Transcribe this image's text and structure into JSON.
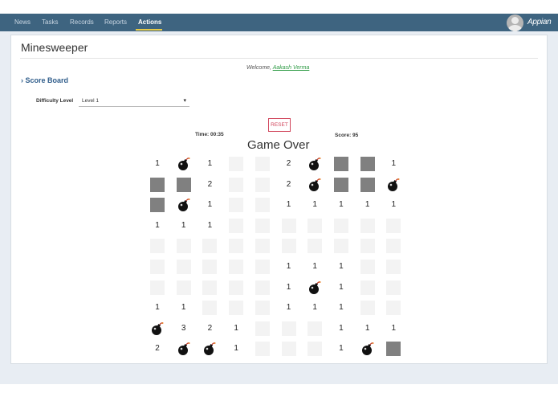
{
  "nav": {
    "items": [
      {
        "label": "News"
      },
      {
        "label": "Tasks"
      },
      {
        "label": "Records"
      },
      {
        "label": "Reports"
      },
      {
        "label": "Actions"
      }
    ],
    "active": "Actions",
    "brand": "Appian"
  },
  "page": {
    "title": "Minesweeper",
    "welcome_prefix": "Welcome,",
    "user_name": "Aakash Verma",
    "scoreboard_label": "Score Board"
  },
  "difficulty": {
    "label": "Difficulty Level",
    "selected": "Level 1"
  },
  "game": {
    "reset_label": "RESET",
    "time_text": "Time: 00:35",
    "score_text": "Score: 95",
    "status_text": "Game Over"
  },
  "board": [
    [
      "1",
      "B",
      "1",
      "",
      "",
      "2",
      "B",
      "G",
      "G",
      "1"
    ],
    [
      "G",
      "G",
      "2",
      "",
      "",
      "2",
      "B",
      "G",
      "G",
      "B"
    ],
    [
      "G",
      "B",
      "1",
      "",
      "",
      "1",
      "1",
      "1",
      "1",
      "1"
    ],
    [
      "1",
      "1",
      "1",
      "",
      "",
      "",
      "",
      "",
      "",
      ""
    ],
    [
      "",
      "",
      "",
      "",
      "",
      "",
      "",
      "",
      "",
      ""
    ],
    [
      "",
      "",
      "",
      "",
      "",
      "1",
      "1",
      "1",
      "",
      ""
    ],
    [
      "",
      "",
      "",
      "",
      "",
      "1",
      "B",
      "1",
      "",
      ""
    ],
    [
      "1",
      "1",
      "",
      "",
      "",
      "1",
      "1",
      "1",
      "",
      ""
    ],
    [
      "B",
      "3",
      "2",
      "1",
      "",
      "",
      "",
      "1",
      "1",
      "1"
    ],
    [
      "2",
      "B",
      "B",
      "1",
      "",
      "",
      "",
      "1",
      "B",
      "G"
    ]
  ],
  "colors": {
    "topbar": "#3e6480",
    "active_underline": "#e4c847",
    "reset": "#d1465c",
    "link": "#2e9b45",
    "scoreboard": "#2e5c8a",
    "revealed_gray": "#808080",
    "hidden_cell": "#f3f3f3"
  },
  "icons": {
    "bomb": "bomb-icon",
    "chevron": "chevron-right-icon",
    "caret": "chevron-down-icon",
    "avatar": "user-avatar-icon"
  }
}
